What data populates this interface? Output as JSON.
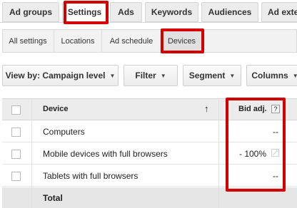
{
  "tabs": [
    {
      "label": "Ad groups"
    },
    {
      "label": "Settings"
    },
    {
      "label": "Ads"
    },
    {
      "label": "Keywords"
    },
    {
      "label": "Audiences"
    },
    {
      "label": "Ad exte"
    }
  ],
  "subtabs": [
    {
      "label": "All settings"
    },
    {
      "label": "Locations"
    },
    {
      "label": "Ad schedule"
    },
    {
      "label": "Devices"
    }
  ],
  "toolbar": {
    "view_by": "View by: Campaign level",
    "filter": "Filter",
    "segment": "Segment",
    "columns": "Columns"
  },
  "table": {
    "headers": {
      "device": "Device",
      "bid_adj": "Bid adj.",
      "help": "?",
      "sort_arrow": "↑"
    },
    "rows": [
      {
        "device": "Computers",
        "bid_adj": "--"
      },
      {
        "device": "Mobile devices with full browsers",
        "bid_adj": "- 100%"
      },
      {
        "device": "Tablets with full browsers",
        "bid_adj": "--"
      }
    ],
    "total_label": "Total"
  },
  "icons": {
    "caret": "caret-down-icon",
    "sort": "sort-arrow-up-icon",
    "edit": "pencil-icon",
    "help": "help-icon"
  },
  "colors": {
    "highlight": "#d40000"
  }
}
